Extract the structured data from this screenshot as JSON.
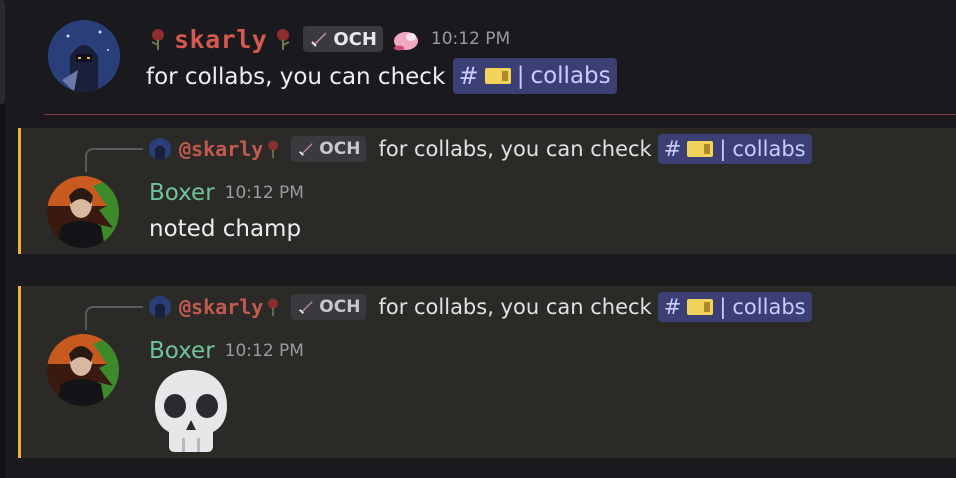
{
  "messages": [
    {
      "author": "skarly",
      "tag": "OCH",
      "time": "10:12 PM",
      "text": "for collabs, you can check",
      "channel": "collabs"
    },
    {
      "reply": {
        "author": "@skarly",
        "tag": "OCH",
        "text": "for collabs, you can check",
        "channel": "collabs"
      },
      "author": "Boxer",
      "time": "10:12 PM",
      "text": "noted champ"
    },
    {
      "reply": {
        "author": "@skarly",
        "tag": "OCH",
        "text": "for collabs, you can check",
        "channel": "collabs"
      },
      "author": "Boxer",
      "time": "10:12 PM",
      "emoji": "skull-emoji"
    }
  ],
  "colors": {
    "skarly_name": "#d6584e",
    "boxer_name": "#6fc49a",
    "mention_bar": "#f0b232",
    "channel_bg": "#3c3f73"
  }
}
